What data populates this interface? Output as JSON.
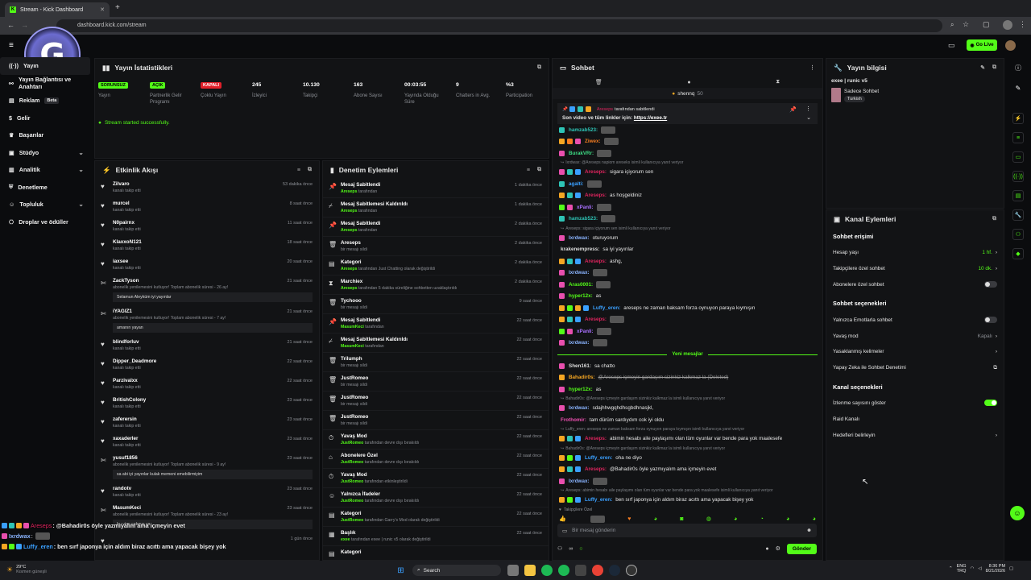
{
  "browser": {
    "tab_title": "Stream - Kick Dashboard",
    "url": "dashboard.kick.com/stream"
  },
  "topbar": {
    "go_live": "Go Live"
  },
  "sidebar": {
    "items": [
      {
        "label": "Yayın"
      },
      {
        "label": "Yayın Bağlantısı ve Anahtarı"
      },
      {
        "label": "Reklam",
        "badge": "Beta"
      },
      {
        "label": "Gelir"
      },
      {
        "label": "Başarılar"
      },
      {
        "label": "Stüdyo"
      },
      {
        "label": "Analitik"
      },
      {
        "label": "Denetleme"
      },
      {
        "label": "Topluluk"
      },
      {
        "label": "Droplar ve ödüller"
      }
    ]
  },
  "stats": {
    "title": "Yayın İstatistikleri",
    "items": [
      {
        "badge": "SORUNSUZ",
        "label": "Yayın"
      },
      {
        "badge": "AÇIK",
        "label": "Partnerlik Gelir Programı"
      },
      {
        "badge": "KAPALI",
        "label": "Çoklu Yayın"
      },
      {
        "value": "245",
        "label": "İzleyici"
      },
      {
        "value": "10.130",
        "label": "Takipçi"
      },
      {
        "value": "163",
        "label": "Abone Sayısı"
      },
      {
        "value": "00:03:55",
        "label": "Yayında Olduğu Süre"
      },
      {
        "value": "9",
        "label": "Chatters in Avg."
      },
      {
        "value": "%3",
        "label": "Participation"
      }
    ],
    "status": "Stream started successfully."
  },
  "activity": {
    "title": "Etkinlik Akışı",
    "items": [
      {
        "name": "Zilvaro",
        "sub": "kanalı takip etti",
        "time": "53 dakika önce"
      },
      {
        "name": "murcel",
        "sub": "kanalı takip etti",
        "time": "8 saat önce"
      },
      {
        "name": "N0pairnx",
        "sub": "kanalı takip etti",
        "time": "11 saat önce"
      },
      {
        "name": "KlaxxoN121",
        "sub": "kanalı takip etti",
        "time": "18 saat önce"
      },
      {
        "name": "iaxsee",
        "sub": "kanalı takip etti",
        "time": "20 saat önce"
      },
      {
        "name": "ZackTyson",
        "sub": "abonelik yenilemesini kutluyor! Toplam abonelik süresi - 26 ay!",
        "time": "21 saat önce",
        "quote": "Selamun Aleyküm iyi yayınlar"
      },
      {
        "name": "iYAGIZ1",
        "sub": "abonelik yenilemesini kutluyor! Toplam abonelik süresi - 7 ay!",
        "time": "21 saat önce",
        "quote": "amanın yayan"
      },
      {
        "name": "blindforluv",
        "sub": "kanalı takip etti",
        "time": "21 saat önce"
      },
      {
        "name": "Dipper_Deadmore",
        "sub": "kanalı takip etti",
        "time": "22 saat önce"
      },
      {
        "name": "Parzivalxx",
        "sub": "kanalı takip etti",
        "time": "22 saat önce"
      },
      {
        "name": "BritishColony",
        "sub": "kanalı takip etti",
        "time": "23 saat önce"
      },
      {
        "name": "zaferersin",
        "sub": "kanalı takip etti",
        "time": "23 saat önce"
      },
      {
        "name": "xaxaderler",
        "sub": "kanalı takip etti",
        "time": "23 saat önce"
      },
      {
        "name": "yusuf1856",
        "sub": "abonelik yenilemesini kutluyor! Toplam abonelik süresi - 9 ay!",
        "time": "23 saat önce",
        "quote": "sa abi iyi yayınlar kulak memeni emebilirmiyim"
      },
      {
        "name": "randotv",
        "sub": "kanalı takip etti",
        "time": "23 saat önce"
      },
      {
        "name": "MasumKeci",
        "sub": "abonelik yenilemesini kutluyor! Toplam abonelik süresi - 23 ay!",
        "time": "23 saat önce",
        "quote": "bu yine çakmış ya"
      },
      {
        "name": "",
        "sub": "",
        "time": "1 gün önce"
      }
    ]
  },
  "moderation": {
    "title": "Denetim Eylemleri",
    "items": [
      {
        "action": "Mesaj Sabitlendi",
        "actor": "Areseps",
        "rest": " tarafından",
        "time": "1 dakika önce",
        "icon": "pin"
      },
      {
        "action": "Mesaj Sabitlemesi Kaldırıldı",
        "actor": "Areseps",
        "rest": " tarafından",
        "time": "1 dakika önce",
        "icon": "unpin"
      },
      {
        "action": "Mesaj Sabitlendi",
        "actor": "Areseps",
        "rest": " tarafından",
        "time": "2 dakika önce",
        "icon": "pin"
      },
      {
        "action": "Areseps",
        "actor": "",
        "rest": "bir mesajı sildi",
        "time": "2 dakika önce",
        "icon": "trash"
      },
      {
        "action": "Kategori",
        "actor": "Areseps",
        "rest": " tarafından Just Chatting olarak değiştirildi",
        "time": "2 dakika önce",
        "icon": "cat"
      },
      {
        "action": "Marchiex",
        "actor": "Areseps",
        "rest": " tarafından 5 dakika süreliğine sohbetten uzaklaştırıldı",
        "time": "2 dakika önce",
        "icon": "timeout"
      },
      {
        "action": "Tychooo",
        "actor": "",
        "rest": "bir mesajı sildi",
        "time": "9 saat önce",
        "icon": "trash"
      },
      {
        "action": "Mesaj Sabitlendi",
        "actor": "MasumKeci",
        "rest": " tarafından",
        "time": "22 saat önce",
        "icon": "pin"
      },
      {
        "action": "Mesaj Sabitlemesi Kaldırıldı",
        "actor": "MasumKeci",
        "rest": " tarafından",
        "time": "22 saat önce",
        "icon": "unpin"
      },
      {
        "action": "Trilumph",
        "actor": "",
        "rest": "bir mesajı sildi",
        "time": "22 saat önce",
        "icon": "trash"
      },
      {
        "action": "JustRomeo",
        "actor": "",
        "rest": "bir mesajı sildi",
        "time": "22 saat önce",
        "icon": "trash"
      },
      {
        "action": "JustRomeo",
        "actor": "",
        "rest": "bir mesajı sildi",
        "time": "22 saat önce",
        "icon": "trash"
      },
      {
        "action": "JustRomeo",
        "actor": "",
        "rest": "bir mesajı sildi",
        "time": "22 saat önce",
        "icon": "trash"
      },
      {
        "action": "Yavaş Mod",
        "actor": "JustRomeo",
        "rest": " tarafından devre dışı bırakıldı",
        "time": "22 saat önce",
        "icon": "slow"
      },
      {
        "action": "Abonelere Özel",
        "actor": "JustRomeo",
        "rest": " tarafından devre dışı bırakıldı",
        "time": "22 saat önce",
        "icon": "sub"
      },
      {
        "action": "Yavaş Mod",
        "actor": "JustRomeo",
        "rest": " tarafından etkinleştirildi",
        "time": "22 saat önce",
        "icon": "slow"
      },
      {
        "action": "Yalnızca İfadeler",
        "actor": "JustRomeo",
        "rest": " tarafından devre dışı bırakıldı",
        "time": "22 saat önce",
        "icon": "emote"
      },
      {
        "action": "Kategori",
        "actor": "JustRomeo",
        "rest": " tarafından Garry's Mod olarak değiştirildi",
        "time": "22 saat önce",
        "icon": "cat"
      },
      {
        "action": "Başlık",
        "actor": "exee",
        "rest": " tarafından exee | runic v5 olarak değiştirildi",
        "time": "22 saat önce",
        "icon": "title"
      },
      {
        "action": "Kategori",
        "actor": "",
        "rest": "",
        "time": "",
        "icon": "cat"
      }
    ]
  },
  "chat": {
    "title": "Sohbet",
    "viewer_user": "shennq",
    "viewer_count": "50",
    "pinned_by": "Areseps",
    "pinned_label": "tarafından sabitlendi",
    "pinned_text": "Son video ve tüm linkler için:",
    "pinned_link": "https://exee.tr",
    "new_messages": "Yeni mesajlar",
    "placeholder": "Bir mesaj gönderin",
    "send": "Gönder",
    "followers_only": "Takipçilere Özel",
    "messages": [
      {
        "user": "hamzab523:",
        "text": "",
        "color": "#2ec4b6",
        "badges": [
          "bc"
        ],
        "emote": true
      },
      {
        "user": "Ziwex:",
        "text": "",
        "color": "#f47c20",
        "badges": [
          "by",
          "bo",
          "bp"
        ],
        "emote": true
      },
      {
        "user": "BurakVRr:",
        "text": "",
        "color": "#3ddc84",
        "badges": [
          "bp"
        ],
        "emote": true
      },
      {
        "reply": "Ixrdwax: @Areseps napiom areseks isimli kullanıcıya yanıt veriyor"
      },
      {
        "user": "Areseps:",
        "text": "sigara içiyorum sen",
        "color": "#e0245e",
        "badges": [
          "bp",
          "bc",
          "bb"
        ]
      },
      {
        "user": "agalti:",
        "text": "",
        "color": "#3aa0ff",
        "badges": [
          "bc"
        ],
        "emote": true
      },
      {
        "user": "Areseps:",
        "text": "as hoşgeldiniz",
        "color": "#e0245e",
        "badges": [
          "by",
          "bc",
          "bb"
        ]
      },
      {
        "user": "xPanli:",
        "text": "",
        "color": "#a970ff",
        "badges": [
          "bg",
          "bp"
        ],
        "emote": true
      },
      {
        "user": "hamzab523:",
        "text": "",
        "color": "#2ec4b6",
        "badges": [
          "bc"
        ],
        "emote": true
      },
      {
        "reply": "Areseps: sigara içiyorum sen isimli kullanıcıya yanıt veriyor"
      },
      {
        "user": "Ixrdwax:",
        "text": "oturuyorum",
        "color": "#8ab4ff",
        "badges": [
          "bp"
        ]
      },
      {
        "user": "krakenempress:",
        "text": "sa iyi yayınlar",
        "color": "#dddddd",
        "badges": []
      },
      {
        "user": "Areseps:",
        "text": "ashg,",
        "color": "#e0245e",
        "badges": [
          "by",
          "bc",
          "bb"
        ]
      },
      {
        "user": "Ixrdwax:",
        "text": "",
        "color": "#8ab4ff",
        "badges": [
          "bp"
        ],
        "emote": true
      },
      {
        "user": "Aras0001:",
        "text": "",
        "color": "#53fc18",
        "badges": [
          "bp"
        ],
        "emote": true
      },
      {
        "user": "hyper12x:",
        "text": "as",
        "color": "#53fc18",
        "badges": [
          "bp"
        ]
      },
      {
        "user": "Luffy_eren:",
        "text": "areseps ne zaman baksam forza oynuyon paraya kıymışın",
        "color": "#3aa0ff",
        "badges": [
          "by",
          "bg",
          "by",
          "bb"
        ]
      },
      {
        "user": "Areseps:",
        "text": "",
        "color": "#e0245e",
        "badges": [
          "by",
          "bc",
          "bb"
        ],
        "emote": true
      },
      {
        "user": "xPanli:",
        "text": "",
        "color": "#a970ff",
        "badges": [
          "bg",
          "bp"
        ],
        "emote": true
      },
      {
        "user": "Ixrdwax:",
        "text": "",
        "color": "#8ab4ff",
        "badges": [
          "bp"
        ],
        "emote": true
      }
    ],
    "messages2": [
      {
        "user": "Shen161:",
        "text": "sa chatto",
        "color": "#dddddd",
        "badges": [
          "bp"
        ]
      },
      {
        "user": "Bahadir0s:",
        "text": "@Areseps içmeyin gardaşım sizinkiz kalkmaz la (Deleted)",
        "color": "#f5a623",
        "badges": [
          "by"
        ]
      },
      {
        "user": "hyper12x:",
        "text": "as",
        "color": "#53fc18",
        "badges": [
          "bp"
        ]
      },
      {
        "reply": "Bahadir0s: @Areseps içmeyin gardaşım sizinkiz kalkmaz la isimli kullanıcıya yanıt veriyor"
      },
      {
        "user": "Ixrdwax:",
        "text": "sdajhhwgqhdhsgbdhnasjkl,",
        "color": "#8ab4ff",
        "badges": [
          "bp"
        ]
      },
      {
        "user": "Frothomir:",
        "text": "tam dürüm sardıydım cok iyi oldu",
        "color": "#e94fae",
        "badges": []
      },
      {
        "reply": "Luffy_eren: areseps ne zaman baksam forza oynuyon paraya kıymışın isimli kullanıcıya yanıt veriyor"
      },
      {
        "user": "Areseps:",
        "text": "abimin hesabı aile paylaşımı olan tüm oyunlar var bende para yok maalesefe",
        "color": "#e0245e",
        "badges": [
          "by",
          "bc",
          "bb"
        ]
      },
      {
        "reply": "Bahadir0s: @Areseps içmeyin gardaşım sizinkiz kalkmaz la isimli kullanıcıya yanıt veriyor"
      },
      {
        "user": "Luffy_eren:",
        "text": "oha ne diyo",
        "color": "#3aa0ff",
        "badges": [
          "by",
          "bg",
          "bb"
        ]
      },
      {
        "user": "Areseps:",
        "text": "@Bahadir0s öyle yazmıyalım ama içmeyin evet",
        "color": "#e0245e",
        "badges": [
          "by",
          "bc",
          "bb"
        ]
      },
      {
        "user": "Ixrdwax:",
        "text": "",
        "color": "#8ab4ff",
        "badges": [
          "bp"
        ],
        "emote": true
      },
      {
        "reply": "Areseps: abimin hesabı aile paylaşımı olan tüm oyunlar var bende para yok maalesefe isimli kullanıcıya yanıt veriyor"
      },
      {
        "user": "Luffy_eren:",
        "text": "ben sırf japonya için aldım biraz acıttı ama yapacak bişey yok",
        "color": "#3aa0ff",
        "badges": [
          "by",
          "bg",
          "bb"
        ]
      }
    ]
  },
  "stream_info": {
    "title": "Yayın bilgisi",
    "stream_title": "exee | runic v5",
    "mode": "Sadece Sohbet",
    "language": "Turkish"
  },
  "channel_actions": {
    "title": "Kanal Eylemleri",
    "chat_access": "Sohbet erişimi",
    "chat_options": "Sohbet seçenekleri",
    "channel_options": "Kanal seçenekleri",
    "rows1": [
      {
        "label": "Hesap yaşı",
        "value": "1 hf.",
        "type": "link"
      },
      {
        "label": "Takipçilere özel sohbet",
        "value": "10 dk.",
        "type": "link"
      },
      {
        "label": "Abonelere özel sohbet",
        "value": "",
        "type": "toggle_off"
      }
    ],
    "rows2": [
      {
        "label": "Yalnızca Emotlarla sohbet",
        "value": "",
        "type": "toggle_off"
      },
      {
        "label": "Yavaş mod",
        "value": "Kapalı",
        "type": "link_gray"
      },
      {
        "label": "Yasaklanmış kelimeler",
        "value": "",
        "type": "link"
      },
      {
        "label": "Yapay Zeka ile Sohbet Denetimi",
        "value": "",
        "type": "ext"
      }
    ],
    "rows3": [
      {
        "label": "İzlenme sayısını göster",
        "value": "",
        "type": "toggle_on"
      },
      {
        "label": "Raid Kanalı",
        "value": "",
        "type": "none"
      },
      {
        "label": "Hedefleri belirleyin",
        "value": "",
        "type": "link"
      }
    ]
  },
  "overlay_chat": [
    {
      "user": "Areseps",
      "text": ": @Bahadir0s öyle yazmıyalım ama içmeyin evet",
      "color": "#e0245e"
    },
    {
      "user": "Ixrdwax",
      "text": ":",
      "color": "#8ab4ff"
    },
    {
      "user": "Luffy_eren",
      "text": ": ben sırf japonya için aldım biraz acıttı ama yapacak bişey yok",
      "color": "#3aa0ff"
    }
  ],
  "taskbar": {
    "weather_temp": "29°C",
    "weather_desc": "Kısmen güneşli",
    "search": "Search",
    "lang1": "ENG",
    "lang2": "TRQ",
    "time": "8:36 PM",
    "date": "8/21/2026"
  }
}
